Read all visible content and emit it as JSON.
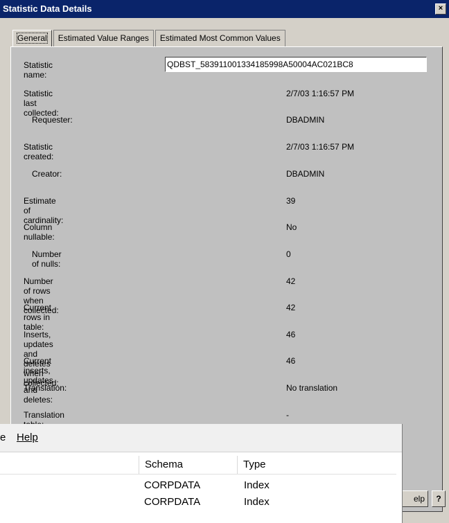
{
  "dialog": {
    "title": "Statistic Data Details",
    "close_glyph": "×",
    "tabs": [
      "General",
      "Estimated Value Ranges",
      "Estimated Most Common Values"
    ],
    "statistic_name_label": "Statistic name:",
    "statistic_name_value": "QDBST_583911001334185998A50004AC021BC8",
    "fields": [
      {
        "label": "Statistic last collected:",
        "value": "2/7/03 1:16:57 PM"
      },
      {
        "label": "Requester:",
        "value": "DBADMIN"
      },
      {
        "label": "Statistic created:",
        "value": "2/7/03 1:16:57 PM"
      },
      {
        "label": "Creator:",
        "value": "DBADMIN"
      },
      {
        "label": "Estimate of cardinality:",
        "value": "39"
      },
      {
        "label": "Column nullable:",
        "value": "No"
      },
      {
        "label": "Number of nulls:",
        "value": "0"
      },
      {
        "label": "Number of rows when collected:",
        "value": "42"
      },
      {
        "label": "Current rows in table:",
        "value": "42"
      },
      {
        "label": "Inserts, updates and deletes when collected:",
        "value": "46"
      },
      {
        "label": "Current inserts, updates and deletes:",
        "value": "46"
      },
      {
        "label": "Translation:",
        "value": "No translation"
      },
      {
        "label": "Translation table:",
        "value": "-"
      }
    ],
    "help_button_label": "elp",
    "question_button_label": "?"
  },
  "background_window": {
    "menu": {
      "partial_item": "e",
      "help": "Help"
    },
    "columns": {
      "schema": "Schema",
      "type": "Type"
    },
    "rows": [
      {
        "schema": "CORPDATA",
        "type": "Index"
      },
      {
        "schema": "CORPDATA",
        "type": "Index"
      }
    ]
  }
}
